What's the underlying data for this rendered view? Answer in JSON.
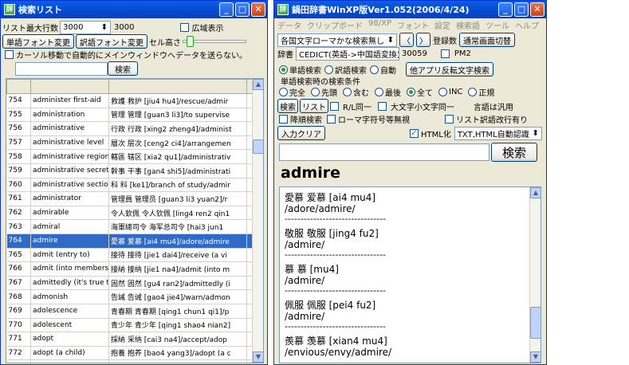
{
  "left": {
    "title": "検索リスト",
    "max_rows_label": "リスト最大行数",
    "max_rows_value": "3000",
    "max_rows_readout": "3000",
    "wide_display_label": "広域表示",
    "word_font_button": "単語フォント変更",
    "trans_font_button": "訳語フォント変更",
    "cell_height_label": "セル高さ",
    "cursor_check_label": "カーソル移動で自動的にメインウィンドウへデータを送らない。",
    "search_button": "検索",
    "rows": [
      [
        "754",
        "administer first-aid",
        "救護 救护 [jiu4 hu4]/rescue/admir"
      ],
      [
        "755",
        "administration",
        "管理 管理 [guan3 li3]/to supervise"
      ],
      [
        "756",
        "administrative",
        "行政 行政 [xing2 zheng4]/administ"
      ],
      [
        "757",
        "administrative level",
        "層次 层次 [ceng2 ci4]/arrangemen"
      ],
      [
        "758",
        "administrative region",
        "轄區 辖区 [xia2 qu1]/administrativ"
      ],
      [
        "759",
        "administrative secretar",
        "幹事 干事 [gan4 shi5]/administrati"
      ],
      [
        "760",
        "administrative section",
        "科 科 [ke1]/branch of study/admir"
      ],
      [
        "761",
        "administrator",
        "管理員 管理员 [guan3 li3 yuan2]/r"
      ],
      [
        "762",
        "admirable",
        "令人欽佩 令人钦佩 [ling4 ren2 qin1"
      ],
      [
        "763",
        "admiral",
        "海軍總司令 海军总司令 [hai3 jun1"
      ],
      [
        "764",
        "admire",
        "愛慕 爱慕 [ai4 mu4]/adore/admire"
      ],
      [
        "765",
        "admit (entry to)",
        "接待 接待 [jie1 dai4]/receive (a vi"
      ],
      [
        "766",
        "admit (into membership",
        "接納 接纳 [jie1 na4]/admit (into m"
      ],
      [
        "767",
        "admittedly (it's true th",
        "固然 固然 [gu4 ran2]/admittedly (i"
      ],
      [
        "768",
        "admonish",
        "告誡 告诫 [gao4 jie4]/warn/admon"
      ],
      [
        "769",
        "adolescence",
        "青春期 青春期 [qing1 chun1 qi1]/p"
      ],
      [
        "770",
        "adolescent",
        "青少年 青少年 [qing1 shao4 nian2]"
      ],
      [
        "771",
        "adopt",
        "採納 采纳 [cai3 na4]/accept/adop"
      ],
      [
        "772",
        "adopt (a child)",
        "抱養 抱养 [bao4 yang3]/adopt (a c"
      ],
      [
        "773",
        "adopt an original appro",
        "別出心裁 别出心裁 [bie2 chu1 xin1"
      ]
    ],
    "selected_row": "764"
  },
  "right": {
    "title": "鍋田辞書WinXP版Ver1.052(2006/4/24)",
    "menu": [
      "データ",
      "クリップボード",
      "98/XP",
      "フォント",
      "設定",
      "検索語",
      "ツール",
      "ヘルプ"
    ],
    "mode_select": "各国文字ローマかな検索無し",
    "register_label": "登録数",
    "register_count": "30059",
    "normal_screen_button": "通常画面切替",
    "dict_label": "辞書",
    "dict_select": "CEDICT(英語->中国語変換)",
    "pm2_label": "PM2",
    "word_search_label": "単語検索",
    "trans_search_label": "訳語検索",
    "auto_label": "自動",
    "other_app_button": "他アプリ反転文字検索",
    "group_label": "単語検索時の検索条件",
    "match_options": [
      "完全",
      "先頭",
      "含む",
      "最後",
      "全て",
      "INC",
      "正規"
    ],
    "search_btn": "検索",
    "list_btn": "リスト",
    "r_same_label": "R/L同一",
    "case_label": "大文字小文字同一",
    "note_label": "言語は汎用",
    "descending_label": "降順検索",
    "roman_label": "ローマ字符号等無視",
    "list_newline_label": "リスト訳語改行有り",
    "input_clear_button": "入力クリア",
    "html_label": "HTML化",
    "html_select": "TXT,HTML自動認識",
    "search_big_button": "検索",
    "query": "admire",
    "results": [
      {
        "head": "愛慕 爱慕 [ai4 mu4]",
        "gloss": "/adore/admire/"
      },
      {
        "head": "敬服 敬服 [jing4 fu2]",
        "gloss": "/admire/"
      },
      {
        "head": "慕 慕 [mu4]",
        "gloss": "/admire/"
      },
      {
        "head": "佩服 佩服 [pei4 fu2]",
        "gloss": "/admire/"
      },
      {
        "head": "羨慕 羡慕 [xian4 mu4]",
        "gloss": "/envious/envy/admire/"
      }
    ],
    "separator": "--------------------------------"
  }
}
